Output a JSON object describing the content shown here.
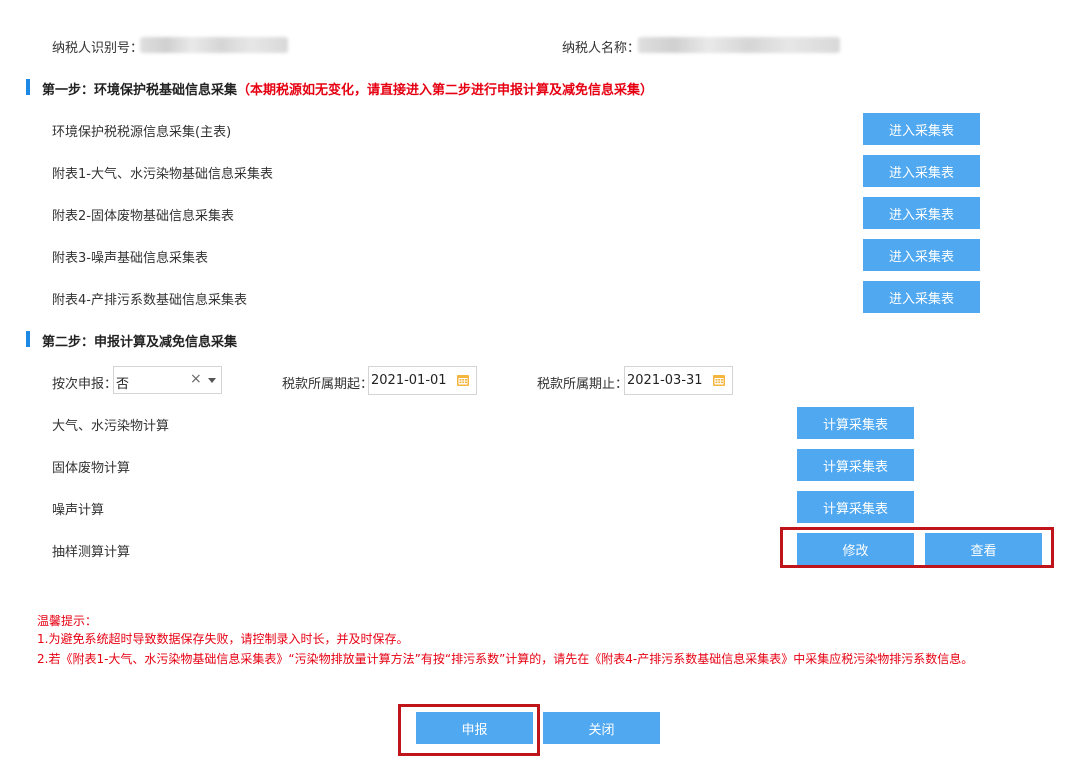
{
  "header": {
    "taxpayer_id_label": "纳税人识别号：",
    "taxpayer_name_label": "纳税人名称："
  },
  "step1": {
    "title": "第一步：环境保护税基础信息采集",
    "note": "（本期税源如无变化，请直接进入第二步进行申报计算及减免信息采集）",
    "rows": [
      {
        "label": "环境保护税税源信息采集(主表)",
        "button": "进入采集表"
      },
      {
        "label": "附表1-大气、水污染物基础信息采集表",
        "button": "进入采集表"
      },
      {
        "label": "附表2-固体废物基础信息采集表",
        "button": "进入采集表"
      },
      {
        "label": "附表3-噪声基础信息采集表",
        "button": "进入采集表"
      },
      {
        "label": "附表4-产排污系数基础信息采集表",
        "button": "进入采集表"
      }
    ]
  },
  "step2": {
    "title": "第二步：申报计算及减免信息采集",
    "filters": {
      "per_time_label": "按次申报：",
      "per_time_value": "否",
      "period_start_label": "税款所属期起：",
      "period_start_value": "2021-01-01",
      "period_end_label": "税款所属期止：",
      "period_end_value": "2021-03-31"
    },
    "rows": [
      {
        "label": "大气、水污染物计算",
        "button": "计算采集表"
      },
      {
        "label": "固体废物计算",
        "button": "计算采集表"
      },
      {
        "label": "噪声计算",
        "button": "计算采集表"
      }
    ],
    "sampling": {
      "label": "抽样测算计算",
      "modify_button": "修改",
      "view_button": "查看"
    }
  },
  "tips": {
    "title": "温馨提示：",
    "line1": "1.为避免系统超时导致数据保存失败，请控制录入时长，并及时保存。",
    "line2": "2.若《附表1-大气、水污染物基础信息采集表》“污染物排放量计算方法”有按“排污系数”计算的，请先在《附表4-产排污系数基础信息采集表》中采集应税污染物排污系数信息。"
  },
  "footer": {
    "submit_button": "申报",
    "close_button": "关闭"
  },
  "colors": {
    "button_blue": "#4fa8f0",
    "step_bar": "#1e88e5",
    "warning_red": "#e60012",
    "highlight_box": "#c0141b"
  }
}
